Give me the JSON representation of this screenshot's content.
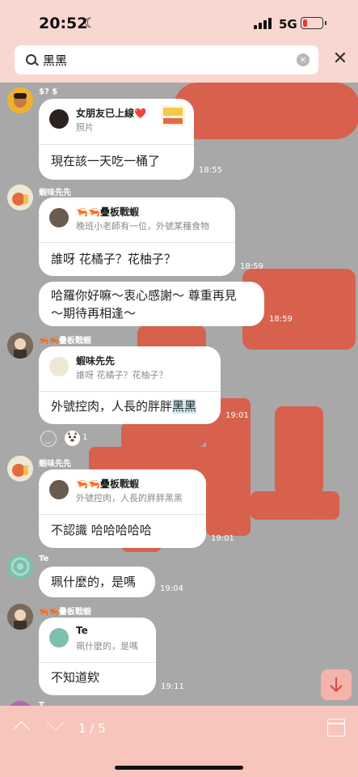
{
  "status_bar": {
    "time": "20:52",
    "network": "5G",
    "battery_percent": 20
  },
  "search": {
    "query": "黑黑",
    "clear_label": "×",
    "close_label": "✕"
  },
  "messages": [
    {
      "sender": "$? $",
      "reply_name": "女朋友已上線❤️",
      "reply_text": "照片",
      "text": "現在該一天吃一桶了",
      "time": "18:55"
    },
    {
      "sender": "蝦味先先",
      "reply_name": "🦐🦐疊板戰蝦",
      "reply_text": "晚班小老師有一位，外號某種食物",
      "text": "誰呀 花橘子？花柚子？",
      "time": "18:59"
    },
    {
      "text_line1": "哈羅你好嘛～衷心感謝～ 尊重再見",
      "text_line2": "～期待再相逢～",
      "time": "18:59"
    },
    {
      "sender": "🦐🦐疊板戰蝦",
      "reply_name": "蝦味先先",
      "reply_text": "誰呀 花橘子？花柚子？",
      "text_before": "外號控肉，人長的胖胖",
      "text_highlight": "黑黑",
      "time": "19:01",
      "reaction_count": "1"
    },
    {
      "sender": "蝦味先先",
      "reply_name": "🦐🦐疊板戰蝦",
      "reply_text": "外號控肉，人長的胖胖黑黑",
      "text": "不認識 哈哈哈哈哈",
      "time": "19:01"
    },
    {
      "sender": "Te",
      "text": "珮什麼的，是嗎",
      "time": "19:04"
    },
    {
      "sender": "🦐🦐疊板戰蝦",
      "reply_name": "Te",
      "reply_text": "珮什麼的，是嗎",
      "text": "不知道欸",
      "time": "19:11"
    }
  ],
  "partial_sender": "T",
  "bottom_bar": {
    "result_counter": "1 / 5"
  },
  "icons": {
    "search": "search-icon",
    "clear": "clear-icon",
    "close": "close-icon",
    "scroll_down": "arrow-down-icon",
    "prev": "chevron-up-icon",
    "next": "chevron-down-icon",
    "calendar": "calendar-icon"
  },
  "colors": {
    "header_bg": "#f9d7d1",
    "bottom_bg": "#f8c5bd",
    "chat_bg": "#a9a9a9",
    "highlight": "#cdebf2",
    "art_red": "#e0553d"
  }
}
